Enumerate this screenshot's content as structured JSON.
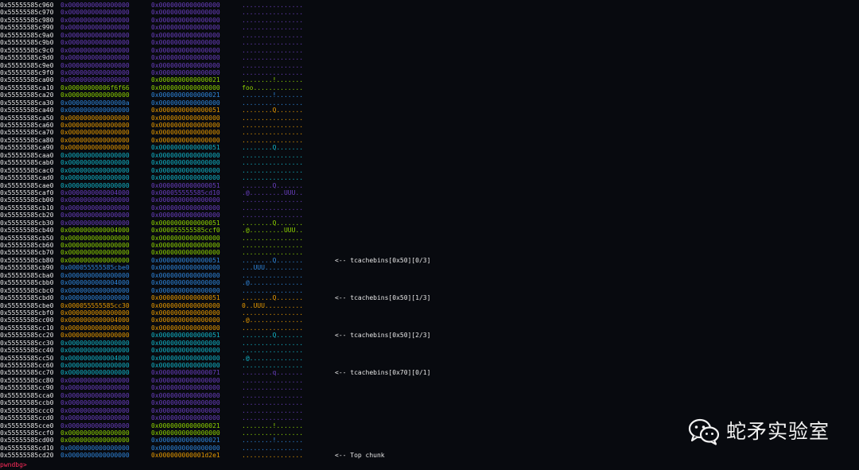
{
  "colors": {
    "address": "#e6e6e6",
    "purple": "#6a3fc0",
    "green": "#8fd400",
    "cyan": "#12b5c9",
    "blue": "#2f86dc",
    "orange": "#e89a00",
    "note": "#e6e6e6",
    "prompt": "#ff2b5a"
  },
  "rows": [
    {
      "addr": "0x55555585c960",
      "q1": "0x0000000000000000",
      "q2": "0x0000000000000000",
      "ascii": "................",
      "c1": "purple",
      "c2": "purple"
    },
    {
      "addr": "0x55555585c970",
      "q1": "0x0000000000000000",
      "q2": "0x0000000000000000",
      "ascii": "................",
      "c1": "purple",
      "c2": "purple"
    },
    {
      "addr": "0x55555585c980",
      "q1": "0x0000000000000000",
      "q2": "0x0000000000000000",
      "ascii": "................",
      "c1": "purple",
      "c2": "purple"
    },
    {
      "addr": "0x55555585c990",
      "q1": "0x0000000000000000",
      "q2": "0x0000000000000000",
      "ascii": "................",
      "c1": "purple",
      "c2": "purple"
    },
    {
      "addr": "0x55555585c9a0",
      "q1": "0x0000000000000000",
      "q2": "0x0000000000000000",
      "ascii": "................",
      "c1": "purple",
      "c2": "purple"
    },
    {
      "addr": "0x55555585c9b0",
      "q1": "0x0000000000000000",
      "q2": "0x0000000000000000",
      "ascii": "................",
      "c1": "purple",
      "c2": "purple"
    },
    {
      "addr": "0x55555585c9c0",
      "q1": "0x0000000000000000",
      "q2": "0x0000000000000000",
      "ascii": "................",
      "c1": "purple",
      "c2": "purple"
    },
    {
      "addr": "0x55555585c9d0",
      "q1": "0x0000000000000000",
      "q2": "0x0000000000000000",
      "ascii": "................",
      "c1": "purple",
      "c2": "purple"
    },
    {
      "addr": "0x55555585c9e0",
      "q1": "0x0000000000000000",
      "q2": "0x0000000000000000",
      "ascii": "................",
      "c1": "purple",
      "c2": "purple"
    },
    {
      "addr": "0x55555585c9f0",
      "q1": "0x0000000000000000",
      "q2": "0x0000000000000000",
      "ascii": "................",
      "c1": "purple",
      "c2": "purple"
    },
    {
      "addr": "0x55555585ca00",
      "q1": "0x0000000000000000",
      "q2": "0x0000000000000021",
      "ascii": "........!.......",
      "c1": "purple",
      "c2": "green"
    },
    {
      "addr": "0x55555585ca10",
      "q1": "0x00000000006f6f66",
      "q2": "0x0000000000000000",
      "ascii": "foo.............",
      "c1": "green",
      "c2": "green"
    },
    {
      "addr": "0x55555585ca20",
      "q1": "0x0000000000000000",
      "q2": "0x0000000000000021",
      "ascii": "........!.......",
      "c1": "green",
      "c2": "blue"
    },
    {
      "addr": "0x55555585ca30",
      "q1": "0x000000000000000a",
      "q2": "0x0000000000000000",
      "ascii": "................",
      "c1": "blue",
      "c2": "blue"
    },
    {
      "addr": "0x55555585ca40",
      "q1": "0x0000000000000000",
      "q2": "0x0000000000000051",
      "ascii": "........Q.......",
      "c1": "blue",
      "c2": "orange"
    },
    {
      "addr": "0x55555585ca50",
      "q1": "0x0000000000000000",
      "q2": "0x0000000000000000",
      "ascii": "................",
      "c1": "orange",
      "c2": "orange"
    },
    {
      "addr": "0x55555585ca60",
      "q1": "0x0000000000000000",
      "q2": "0x0000000000000000",
      "ascii": "................",
      "c1": "orange",
      "c2": "orange"
    },
    {
      "addr": "0x55555585ca70",
      "q1": "0x0000000000000000",
      "q2": "0x0000000000000000",
      "ascii": "................",
      "c1": "orange",
      "c2": "orange"
    },
    {
      "addr": "0x55555585ca80",
      "q1": "0x0000000000000000",
      "q2": "0x0000000000000000",
      "ascii": "................",
      "c1": "orange",
      "c2": "orange"
    },
    {
      "addr": "0x55555585ca90",
      "q1": "0x0000000000000000",
      "q2": "0x0000000000000051",
      "ascii": "........Q.......",
      "c1": "orange",
      "c2": "cyan"
    },
    {
      "addr": "0x55555585caa0",
      "q1": "0x0000000000000000",
      "q2": "0x0000000000000000",
      "ascii": "................",
      "c1": "cyan",
      "c2": "cyan"
    },
    {
      "addr": "0x55555585cab0",
      "q1": "0x0000000000000000",
      "q2": "0x0000000000000000",
      "ascii": "................",
      "c1": "cyan",
      "c2": "cyan"
    },
    {
      "addr": "0x55555585cac0",
      "q1": "0x0000000000000000",
      "q2": "0x0000000000000000",
      "ascii": "................",
      "c1": "cyan",
      "c2": "cyan"
    },
    {
      "addr": "0x55555585cad0",
      "q1": "0x0000000000000000",
      "q2": "0x0000000000000000",
      "ascii": "................",
      "c1": "cyan",
      "c2": "cyan"
    },
    {
      "addr": "0x55555585cae0",
      "q1": "0x0000000000000000",
      "q2": "0x0000000000000051",
      "ascii": "........Q.......",
      "c1": "cyan",
      "c2": "purple"
    },
    {
      "addr": "0x55555585caf0",
      "q1": "0x0000000000004000",
      "q2": "0x000055555585cd10",
      "ascii": ".@.........UUU..",
      "c1": "purple",
      "c2": "purple"
    },
    {
      "addr": "0x55555585cb00",
      "q1": "0x0000000000000000",
      "q2": "0x0000000000000000",
      "ascii": "................",
      "c1": "purple",
      "c2": "purple"
    },
    {
      "addr": "0x55555585cb10",
      "q1": "0x0000000000000000",
      "q2": "0x0000000000000000",
      "ascii": "................",
      "c1": "purple",
      "c2": "purple"
    },
    {
      "addr": "0x55555585cb20",
      "q1": "0x0000000000000000",
      "q2": "0x0000000000000000",
      "ascii": "................",
      "c1": "purple",
      "c2": "purple"
    },
    {
      "addr": "0x55555585cb30",
      "q1": "0x0000000000000000",
      "q2": "0x0000000000000051",
      "ascii": "........Q.......",
      "c1": "purple",
      "c2": "green"
    },
    {
      "addr": "0x55555585cb40",
      "q1": "0x0000000000004000",
      "q2": "0x000055555585ccf0",
      "ascii": ".@.........UUU..",
      "c1": "green",
      "c2": "green"
    },
    {
      "addr": "0x55555585cb50",
      "q1": "0x0000000000000000",
      "q2": "0x0000000000000000",
      "ascii": "................",
      "c1": "green",
      "c2": "green"
    },
    {
      "addr": "0x55555585cb60",
      "q1": "0x0000000000000000",
      "q2": "0x0000000000000000",
      "ascii": "................",
      "c1": "green",
      "c2": "green"
    },
    {
      "addr": "0x55555585cb70",
      "q1": "0x0000000000000000",
      "q2": "0x0000000000000000",
      "ascii": "................",
      "c1": "green",
      "c2": "green"
    },
    {
      "addr": "0x55555585cb80",
      "q1": "0x0000000000000000",
      "q2": "0x0000000000000051",
      "ascii": "........Q.......",
      "c1": "green",
      "c2": "blue",
      "note": "<-- tcachebins[0x50][0/3]"
    },
    {
      "addr": "0x55555585cb90",
      "q1": "0x000055555585cbe0",
      "q2": "0x0000000000000000",
      "ascii": "...UUU..........",
      "c1": "blue",
      "c2": "blue"
    },
    {
      "addr": "0x55555585cba0",
      "q1": "0x0000000000000000",
      "q2": "0x0000000000000000",
      "ascii": "................",
      "c1": "blue",
      "c2": "blue"
    },
    {
      "addr": "0x55555585cbb0",
      "q1": "0x0000000000004000",
      "q2": "0x0000000000000000",
      "ascii": ".@..............",
      "c1": "blue",
      "c2": "blue"
    },
    {
      "addr": "0x55555585cbc0",
      "q1": "0x0000000000000000",
      "q2": "0x0000000000000000",
      "ascii": "................",
      "c1": "blue",
      "c2": "blue"
    },
    {
      "addr": "0x55555585cbd0",
      "q1": "0x0000000000000000",
      "q2": "0x0000000000000051",
      "ascii": "........Q.......",
      "c1": "blue",
      "c2": "orange",
      "note": "<-- tcachebins[0x50][1/3]"
    },
    {
      "addr": "0x55555585cbe0",
      "q1": "0x000055555585cc30",
      "q2": "0x0000000000000000",
      "ascii": "0..UUU..........",
      "c1": "orange",
      "c2": "orange"
    },
    {
      "addr": "0x55555585cbf0",
      "q1": "0x0000000000000000",
      "q2": "0x0000000000000000",
      "ascii": "................",
      "c1": "orange",
      "c2": "orange"
    },
    {
      "addr": "0x55555585cc00",
      "q1": "0x0000000000004000",
      "q2": "0x0000000000000000",
      "ascii": ".@..............",
      "c1": "orange",
      "c2": "orange"
    },
    {
      "addr": "0x55555585cc10",
      "q1": "0x0000000000000000",
      "q2": "0x0000000000000000",
      "ascii": "................",
      "c1": "orange",
      "c2": "orange"
    },
    {
      "addr": "0x55555585cc20",
      "q1": "0x0000000000000000",
      "q2": "0x0000000000000051",
      "ascii": "........Q.......",
      "c1": "orange",
      "c2": "cyan",
      "note": "<-- tcachebins[0x50][2/3]"
    },
    {
      "addr": "0x55555585cc30",
      "q1": "0x0000000000000000",
      "q2": "0x0000000000000000",
      "ascii": "................",
      "c1": "cyan",
      "c2": "cyan"
    },
    {
      "addr": "0x55555585cc40",
      "q1": "0x0000000000000000",
      "q2": "0x0000000000000000",
      "ascii": "................",
      "c1": "cyan",
      "c2": "cyan"
    },
    {
      "addr": "0x55555585cc50",
      "q1": "0x0000000000004000",
      "q2": "0x0000000000000000",
      "ascii": ".@..............",
      "c1": "cyan",
      "c2": "cyan"
    },
    {
      "addr": "0x55555585cc60",
      "q1": "0x0000000000000000",
      "q2": "0x0000000000000000",
      "ascii": "................",
      "c1": "cyan",
      "c2": "cyan"
    },
    {
      "addr": "0x55555585cc70",
      "q1": "0x0000000000000000",
      "q2": "0x0000000000000071",
      "ascii": "........q.......",
      "c1": "cyan",
      "c2": "purple",
      "note": "<-- tcachebins[0x70][0/1]"
    },
    {
      "addr": "0x55555585cc80",
      "q1": "0x0000000000000000",
      "q2": "0x0000000000000000",
      "ascii": "................",
      "c1": "purple",
      "c2": "purple"
    },
    {
      "addr": "0x55555585cc90",
      "q1": "0x0000000000000000",
      "q2": "0x0000000000000000",
      "ascii": "................",
      "c1": "purple",
      "c2": "purple"
    },
    {
      "addr": "0x55555585cca0",
      "q1": "0x0000000000000000",
      "q2": "0x0000000000000000",
      "ascii": "................",
      "c1": "purple",
      "c2": "purple"
    },
    {
      "addr": "0x55555585ccb0",
      "q1": "0x0000000000000000",
      "q2": "0x0000000000000000",
      "ascii": "................",
      "c1": "purple",
      "c2": "purple"
    },
    {
      "addr": "0x55555585ccc0",
      "q1": "0x0000000000000000",
      "q2": "0x0000000000000000",
      "ascii": "................",
      "c1": "purple",
      "c2": "purple"
    },
    {
      "addr": "0x55555585ccd0",
      "q1": "0x0000000000000000",
      "q2": "0x0000000000000000",
      "ascii": "................",
      "c1": "purple",
      "c2": "purple"
    },
    {
      "addr": "0x55555585cce0",
      "q1": "0x0000000000000000",
      "q2": "0x0000000000000021",
      "ascii": "........!.......",
      "c1": "purple",
      "c2": "green"
    },
    {
      "addr": "0x55555585ccf0",
      "q1": "0x0000000000000000",
      "q2": "0x0000000000000000",
      "ascii": "................",
      "c1": "green",
      "c2": "green"
    },
    {
      "addr": "0x55555585cd00",
      "q1": "0x0000000000000000",
      "q2": "0x0000000000000021",
      "ascii": "........!.......",
      "c1": "green",
      "c2": "blue"
    },
    {
      "addr": "0x55555585cd10",
      "q1": "0x0000000000000000",
      "q2": "0x0000000000000000",
      "ascii": "................",
      "c1": "blue",
      "c2": "blue"
    },
    {
      "addr": "0x55555585cd20",
      "q1": "0x0000000000000000",
      "q2": "0x000000000001d2e1",
      "ascii": "................",
      "c1": "blue",
      "c2": "orange",
      "note": "<-- Top chunk"
    }
  ],
  "prompt": "pwndbg>",
  "watermark": {
    "text": "蛇矛实验室",
    "icon": "wechat-icon"
  }
}
